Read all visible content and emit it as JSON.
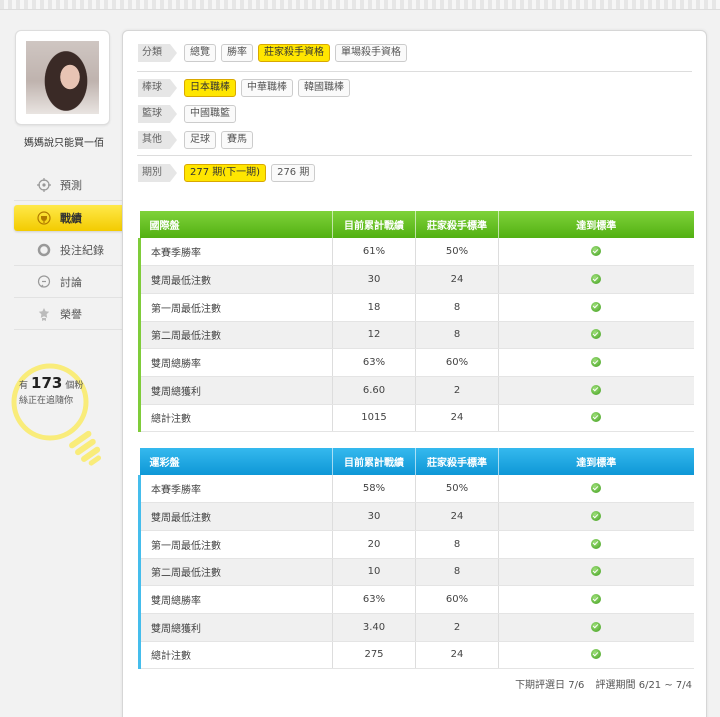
{
  "user": {
    "name": "媽媽說只能買一佰"
  },
  "nav": [
    {
      "label": "預測",
      "icon": "crosshair-icon"
    },
    {
      "label": "戰績",
      "icon": "trophy-icon",
      "active": true
    },
    {
      "label": "投注紀錄",
      "icon": "circle-icon"
    },
    {
      "label": "討論",
      "icon": "chat-icon"
    },
    {
      "label": "榮譽",
      "icon": "medal-icon"
    }
  ],
  "followers": {
    "prefix": "有",
    "count": "173",
    "unit": "個粉",
    "sub": "絲正在追隨你"
  },
  "filters": {
    "category": {
      "label": "分類",
      "options": [
        "總覽",
        "勝率",
        "莊家殺手資格",
        "單場殺手資格"
      ],
      "active": 2
    },
    "baseball": {
      "label": "棒球",
      "options": [
        "日本職棒",
        "中華職棒",
        "韓國職棒"
      ],
      "active": 0
    },
    "basketball": {
      "label": "籃球",
      "options": [
        "中國職籃"
      ]
    },
    "other": {
      "label": "其他",
      "options": [
        "足球",
        "賽馬"
      ]
    },
    "period": {
      "label": "期別",
      "options": [
        "277 期(下一期)",
        "276 期"
      ],
      "active": 0
    }
  },
  "columns": [
    "目前累計戰績",
    "莊家殺手標準",
    "達到標準"
  ],
  "tables": [
    {
      "title": "國際盤",
      "theme": "green",
      "rows": [
        {
          "name": "本賽季勝率",
          "current": "61%",
          "standard": "50%",
          "met": true
        },
        {
          "name": "雙周最低注數",
          "current": "30",
          "standard": "24",
          "met": true
        },
        {
          "name": "第一周最低注數",
          "current": "18",
          "standard": "8",
          "met": true
        },
        {
          "name": "第二周最低注數",
          "current": "12",
          "standard": "8",
          "met": true
        },
        {
          "name": "雙周總勝率",
          "current": "63%",
          "standard": "60%",
          "met": true
        },
        {
          "name": "雙周總獲利",
          "current": "6.60",
          "standard": "2",
          "met": true
        },
        {
          "name": "總計注數",
          "current": "1015",
          "standard": "24",
          "met": true
        }
      ]
    },
    {
      "title": "運彩盤",
      "theme": "blue",
      "rows": [
        {
          "name": "本賽季勝率",
          "current": "58%",
          "standard": "50%",
          "met": true
        },
        {
          "name": "雙周最低注數",
          "current": "30",
          "standard": "24",
          "met": true
        },
        {
          "name": "第一周最低注數",
          "current": "20",
          "standard": "8",
          "met": true
        },
        {
          "name": "第二周最低注數",
          "current": "10",
          "standard": "8",
          "met": true
        },
        {
          "name": "雙周總勝率",
          "current": "63%",
          "standard": "60%",
          "met": true
        },
        {
          "name": "雙周總獲利",
          "current": "3.40",
          "standard": "2",
          "met": true
        },
        {
          "name": "總計注數",
          "current": "275",
          "standard": "24",
          "met": true
        }
      ]
    }
  ],
  "footer": {
    "next_eval": "下期評選日 7/6",
    "eval_period": "評選期間 6/21 ~ 7/4"
  }
}
